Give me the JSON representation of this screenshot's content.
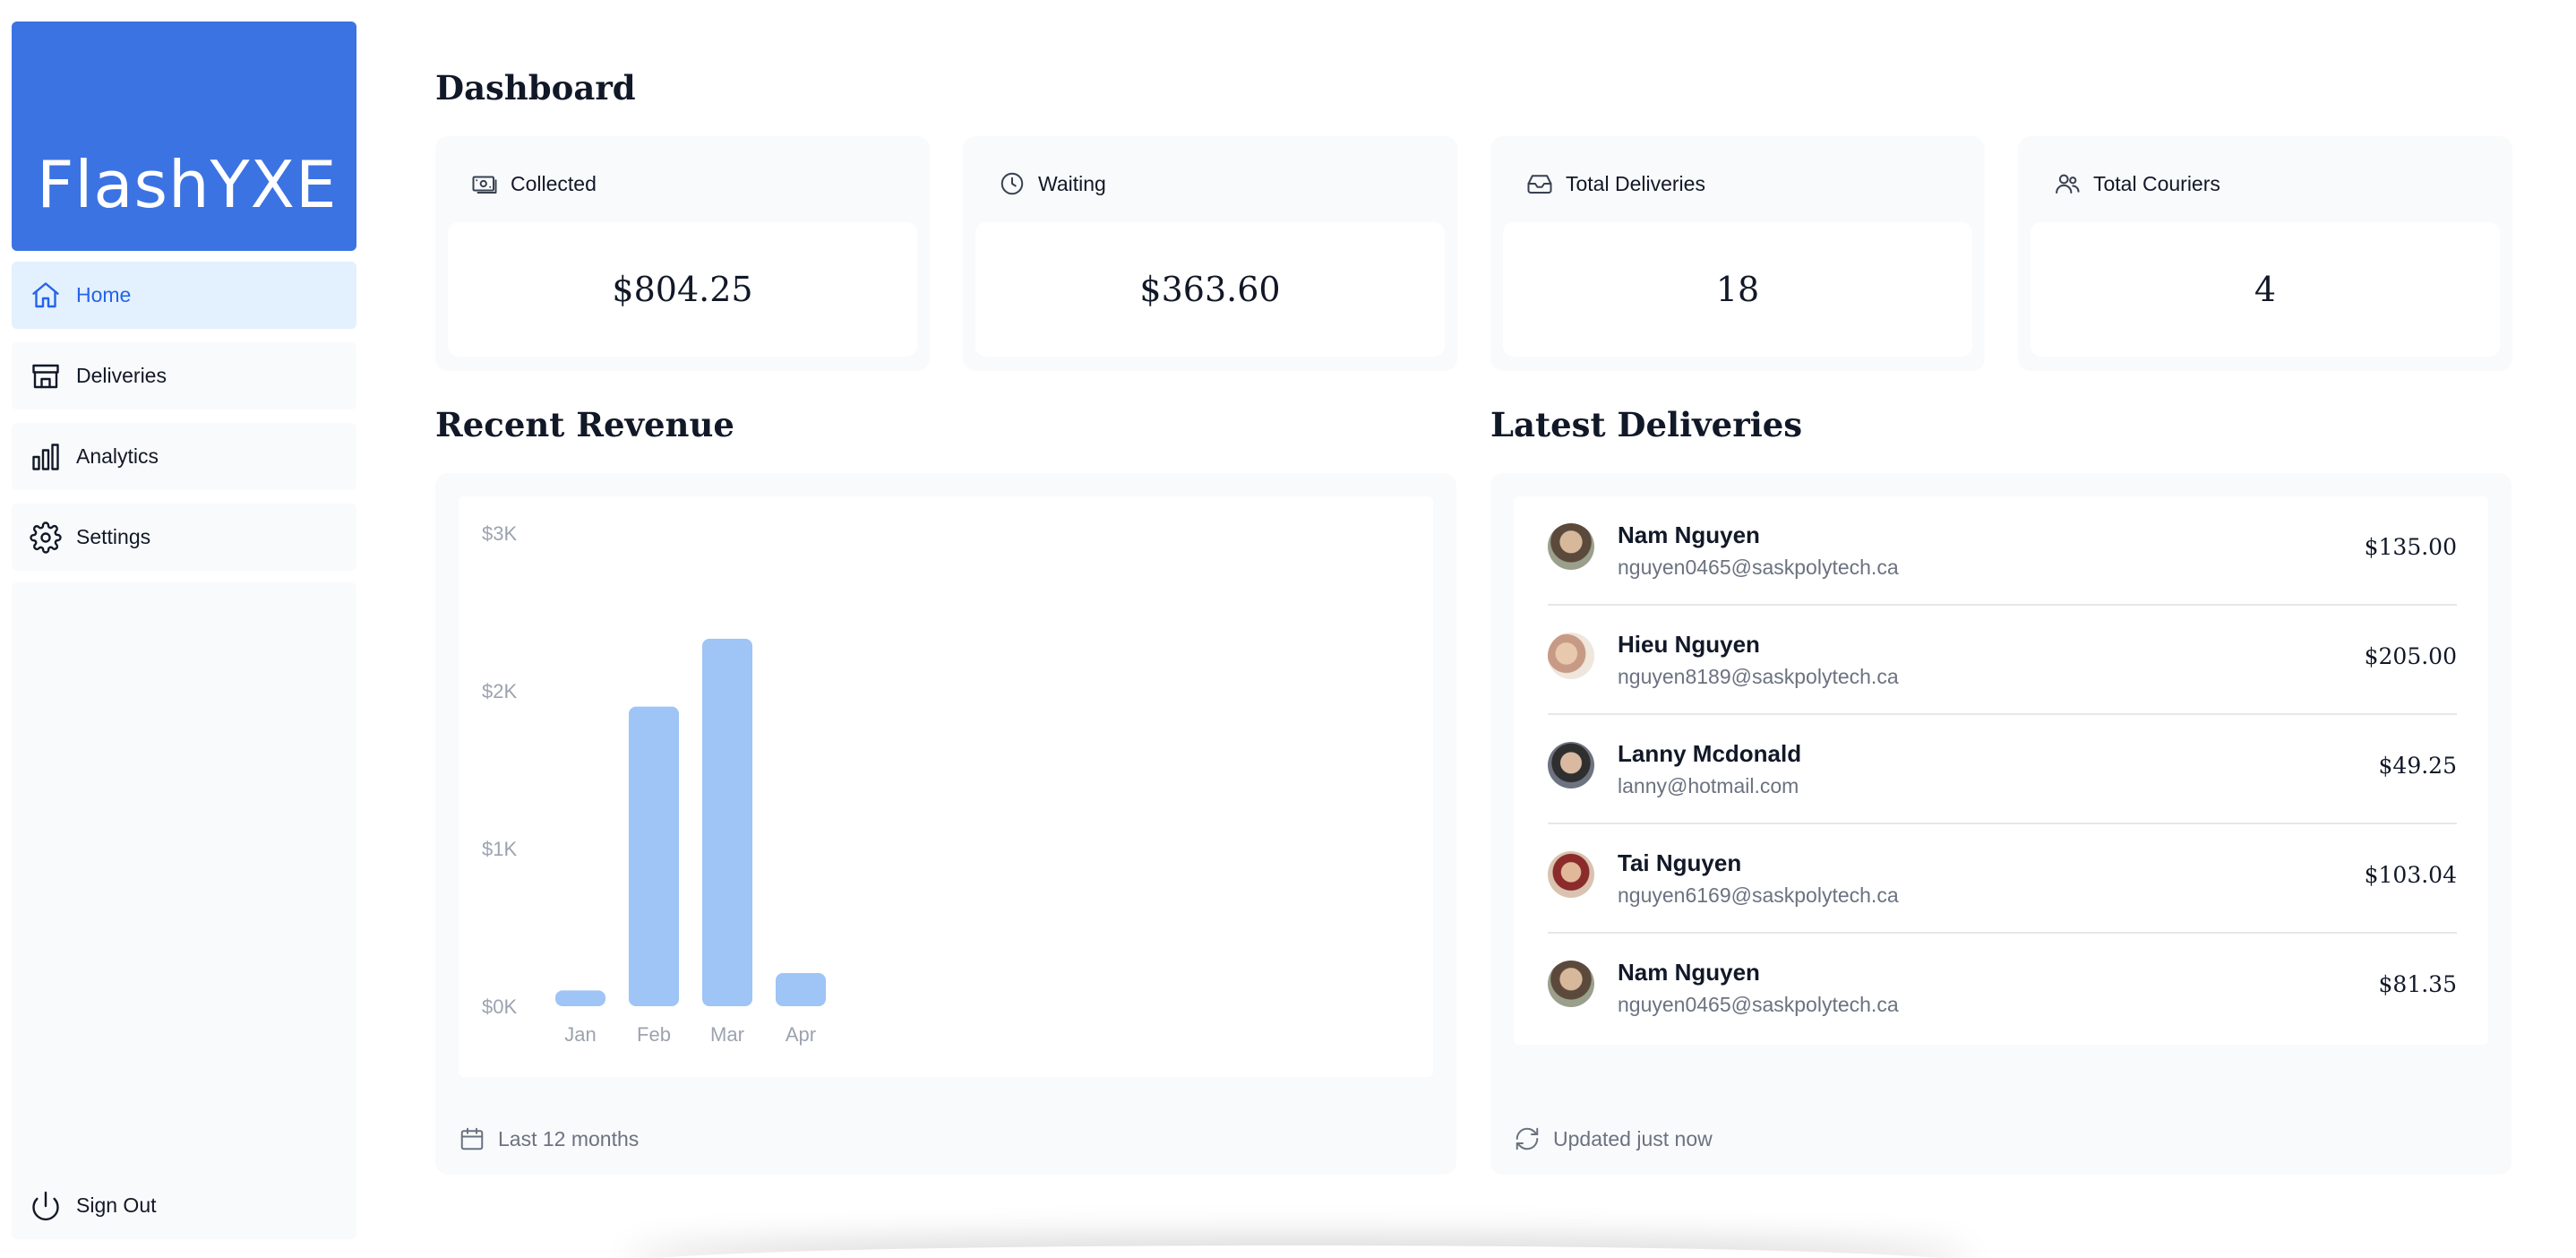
{
  "brand": {
    "name": "FlashYXE",
    "color": "#3b73e3"
  },
  "nav": {
    "home": "Home",
    "deliveries": "Deliveries",
    "analytics": "Analytics",
    "settings": "Settings",
    "signout": "Sign Out"
  },
  "page_title": "Dashboard",
  "cards": [
    {
      "label": "Collected",
      "value": "$804.25",
      "icon": "banknote-icon"
    },
    {
      "label": "Waiting",
      "value": "$363.60",
      "icon": "clock-icon"
    },
    {
      "label": "Total Deliveries",
      "value": "18",
      "icon": "inbox-icon"
    },
    {
      "label": "Total Couriers",
      "value": "4",
      "icon": "users-icon"
    }
  ],
  "revenue": {
    "title": "Recent Revenue",
    "footer": "Last 12 months"
  },
  "chart_data": {
    "type": "bar",
    "categories": [
      "Jan",
      "Feb",
      "Mar",
      "Apr"
    ],
    "values": [
      100,
      1900,
      2330,
      210
    ],
    "ylim": [
      0,
      3000
    ],
    "yticks": [
      "$0K",
      "$1K",
      "$2K",
      "$3K"
    ],
    "color": "#9fc4f6",
    "grid": false
  },
  "latest": {
    "title": "Latest Deliveries",
    "footer": "Updated just now",
    "items": [
      {
        "name": "Nam Nguyen",
        "email": "nguyen0465@saskpolytech.ca",
        "amount": "$135.00"
      },
      {
        "name": "Hieu Nguyen",
        "email": "nguyen8189@saskpolytech.ca",
        "amount": "$205.00"
      },
      {
        "name": "Lanny Mcdonald",
        "email": "lanny@hotmail.com",
        "amount": "$49.25"
      },
      {
        "name": "Tai Nguyen",
        "email": "nguyen6169@saskpolytech.ca",
        "amount": "$103.04"
      },
      {
        "name": "Nam Nguyen",
        "email": "nguyen0465@saskpolytech.ca",
        "amount": "$81.35"
      }
    ]
  }
}
